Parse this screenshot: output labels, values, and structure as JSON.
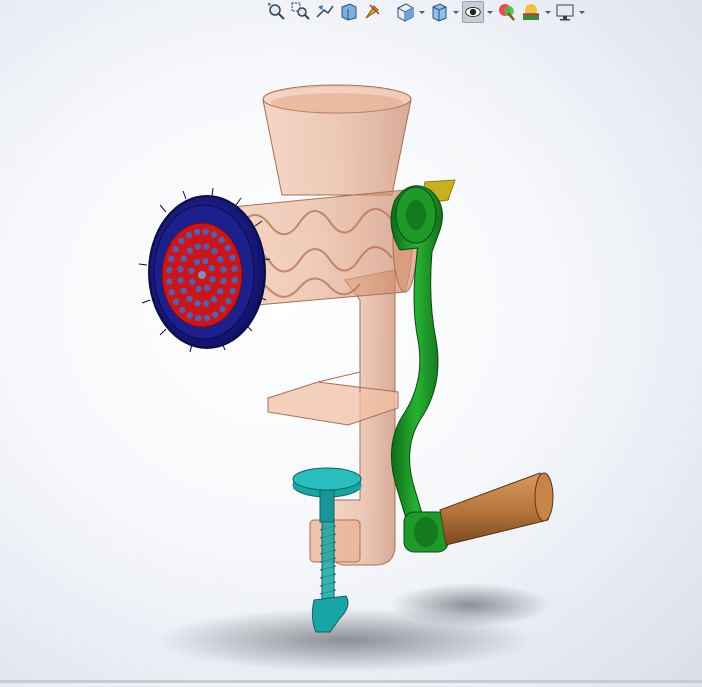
{
  "window": {
    "bottom_strip_color": "#c7ccd4"
  },
  "toolbar": {
    "items": [
      {
        "icon": "zoom-to-fit-icon",
        "has_dropdown": false
      },
      {
        "icon": "zoom-to-area-icon",
        "has_dropdown": false
      },
      {
        "icon": "previous-view-icon",
        "has_dropdown": false
      },
      {
        "icon": "section-view-icon",
        "has_dropdown": false
      },
      {
        "icon": "dynamic-annotation-icon",
        "has_dropdown": false
      },
      {
        "icon": "view-orientation-icon",
        "has_dropdown": true
      },
      {
        "icon": "display-style-icon",
        "has_dropdown": true
      },
      {
        "icon": "hide-show-items-icon",
        "has_dropdown": true,
        "active": true
      },
      {
        "icon": "edit-appearance-icon",
        "has_dropdown": false
      },
      {
        "icon": "apply-scene-icon",
        "has_dropdown": true
      },
      {
        "icon": "view-settings-icon",
        "has_dropdown": true
      }
    ]
  },
  "model": {
    "description_icon": "meat-grinder-assembly-icon",
    "colors": {
      "body": "#e6a88a",
      "grinder_cap": "#1c1f8c",
      "grinder_plate": "#c8161d",
      "crank_arm": "#1f9a2a",
      "handle": "#b9773c",
      "clamp_screw": "#1aa5a5",
      "shaft_key": "#c9b020"
    }
  }
}
